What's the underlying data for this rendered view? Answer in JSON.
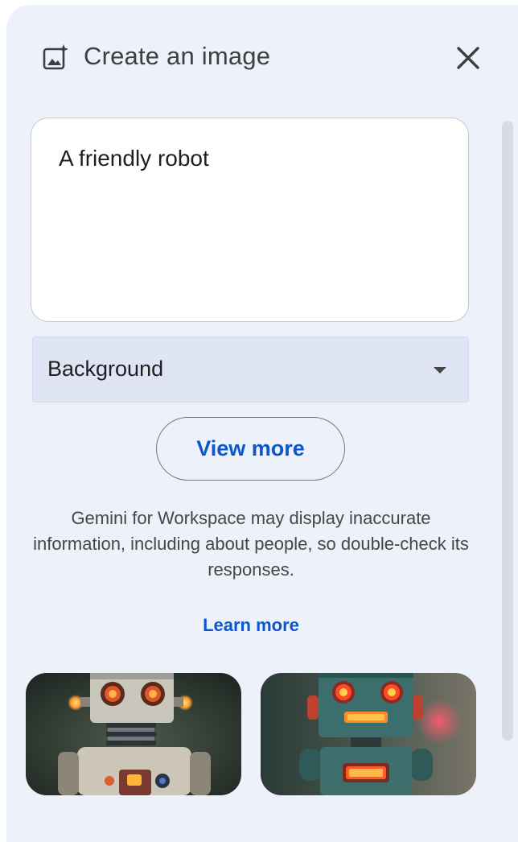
{
  "header": {
    "title": "Create an image",
    "icon": "image-sparkle-icon",
    "close_icon": "close-icon"
  },
  "prompt": {
    "value": "A friendly robot"
  },
  "style_select": {
    "selected": "Background",
    "icon": "dropdown-arrow-icon"
  },
  "view_more_label": "View more",
  "disclaimer": "Gemini for Workspace may display inaccurate information, including about people, so double-check its responses.",
  "learn_more_label": "Learn more",
  "results": [
    {
      "alt": "generated-image-1"
    },
    {
      "alt": "generated-image-2"
    }
  ],
  "colors": {
    "panel_bg": "#edf1f9",
    "accent": "#0b57d0",
    "select_bg": "#dfe5f4"
  }
}
